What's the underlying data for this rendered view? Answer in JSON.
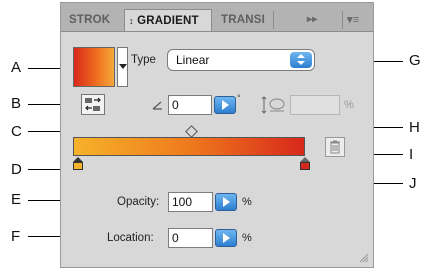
{
  "callouts": [
    "A",
    "B",
    "C",
    "D",
    "E",
    "F",
    "G",
    "H",
    "I",
    "J"
  ],
  "tabs": {
    "stroke": "STROK",
    "gradient": "GRADIENT",
    "transparency": "TRANSI",
    "expand_glyph": "▸▸",
    "menu_glyph": "▾≡"
  },
  "gradient_panel": {
    "type_label": "Type",
    "type_value": "Linear",
    "angle_value": "0",
    "aspect_value": "",
    "aspect_unit": "%",
    "degree_symbol": "°",
    "opacity_label": "Opacity:",
    "opacity_value": "100",
    "opacity_unit": "%",
    "location_label": "Location:",
    "location_value": "0",
    "location_unit": "%"
  },
  "colors": {
    "gradient_start": "#f6b22a",
    "gradient_mid": "#ef7a1d",
    "gradient_end": "#d8281b",
    "accent_blue": "#2c7fd0"
  },
  "icons": {
    "tab_arrows": "double-chevron-icon",
    "panel_menu": "panel-menu-icon",
    "type_dropdown": "stepper-dropdown-icon",
    "reverse": "reverse-gradient-icon",
    "angle": "angle-icon",
    "aspect": "aspect-ratio-icon",
    "delete": "trash-icon"
  }
}
